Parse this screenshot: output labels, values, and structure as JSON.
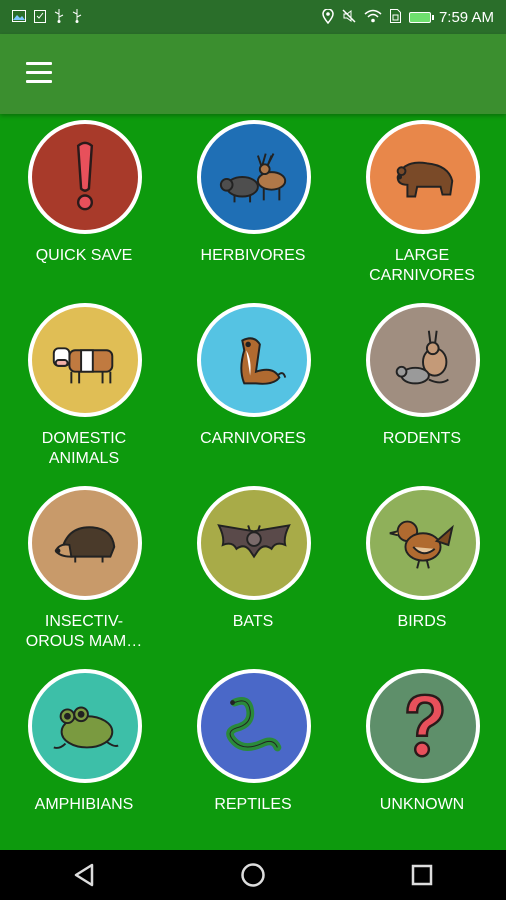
{
  "status_bar": {
    "time": "7:59 AM",
    "left_icons": [
      "gallery-icon",
      "clipboard-icon",
      "usb-icon",
      "usb-icon"
    ],
    "right_icons": [
      "location-icon",
      "mute-icon",
      "wifi-icon",
      "sim-icon",
      "battery-charging-icon"
    ]
  },
  "app_bar": {
    "menu_icon": "hamburger-menu-icon"
  },
  "categories": [
    {
      "label": "QUICK SAVE",
      "color": "#a83a2a",
      "icon": "exclamation-icon"
    },
    {
      "label": "HERBIVORES",
      "color": "#1f6fb5",
      "icon": "boar-deer-icon"
    },
    {
      "label": "LARGE\nCARNIVORES",
      "color": "#e8874a",
      "icon": "bear-icon"
    },
    {
      "label": "DOMESTIC\nANIMALS",
      "color": "#e0be55",
      "icon": "cow-icon"
    },
    {
      "label": "CARNIVORES",
      "color": "#55c3e3",
      "icon": "weasel-icon"
    },
    {
      "label": "RODENTS",
      "color": "#a08e80",
      "icon": "rabbit-rat-icon"
    },
    {
      "label": "INSECTIV-\nOROUS MAM…",
      "color": "#c89a6a",
      "icon": "hedgehog-icon"
    },
    {
      "label": "BATS",
      "color": "#a8ab48",
      "icon": "bat-icon"
    },
    {
      "label": "BIRDS",
      "color": "#8fb05a",
      "icon": "bird-icon"
    },
    {
      "label": "AMPHIBIANS",
      "color": "#3dbfa8",
      "icon": "frog-icon"
    },
    {
      "label": "REPTILES",
      "color": "#4a68c8",
      "icon": "snake-icon"
    },
    {
      "label": "UNKNOWN",
      "color": "#5e8f6a",
      "icon": "question-mark-icon"
    }
  ],
  "nav_bar": {
    "back_icon": "back-triangle-icon",
    "home_icon": "home-circle-icon",
    "recents_icon": "recents-square-icon"
  }
}
